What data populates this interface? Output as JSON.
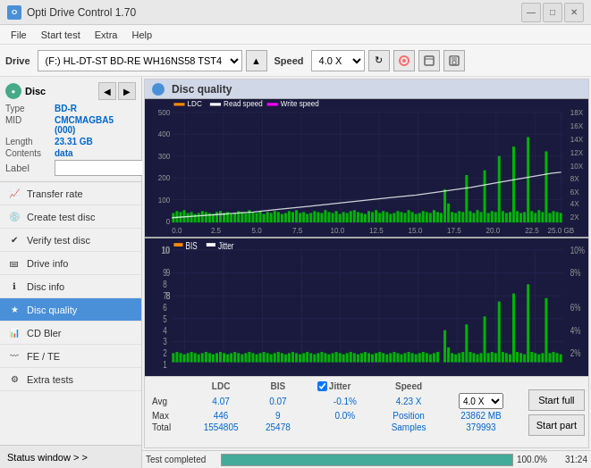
{
  "titlebar": {
    "title": "Opti Drive Control 1.70",
    "icon_text": "O",
    "min_btn": "—",
    "max_btn": "□",
    "close_btn": "✕"
  },
  "menubar": {
    "items": [
      "File",
      "Start test",
      "Extra",
      "Help"
    ]
  },
  "toolbar": {
    "drive_label": "Drive",
    "drive_value": "(F:)  HL-DT-ST BD-RE  WH16NS58 TST4",
    "speed_label": "Speed",
    "speed_value": "4.0 X"
  },
  "disc": {
    "type_label": "Type",
    "type_value": "BD-R",
    "mid_label": "MID",
    "mid_value": "CMCMAGBA5 (000)",
    "length_label": "Length",
    "length_value": "23.31 GB",
    "contents_label": "Contents",
    "contents_value": "data",
    "label_label": "Label",
    "label_value": ""
  },
  "nav": {
    "items": [
      {
        "label": "Transfer rate",
        "active": false
      },
      {
        "label": "Create test disc",
        "active": false
      },
      {
        "label": "Verify test disc",
        "active": false
      },
      {
        "label": "Drive info",
        "active": false
      },
      {
        "label": "Disc info",
        "active": false
      },
      {
        "label": "Disc quality",
        "active": true
      },
      {
        "label": "CD Bler",
        "active": false
      },
      {
        "label": "FE / TE",
        "active": false
      },
      {
        "label": "Extra tests",
        "active": false
      }
    ]
  },
  "status_window": {
    "label": "Status window > >"
  },
  "chart": {
    "title": "Disc quality",
    "legend_top": [
      {
        "label": "LDC",
        "color": "#ff8800"
      },
      {
        "label": "Read speed",
        "color": "#ffffff"
      },
      {
        "label": "Write speed",
        "color": "#ff00ff"
      }
    ],
    "legend_bottom": [
      {
        "label": "BIS",
        "color": "#ff8800"
      },
      {
        "label": "Jitter",
        "color": "#ffffff"
      }
    ],
    "top_y_labels": [
      "500",
      "400",
      "300",
      "200",
      "100",
      "0"
    ],
    "top_y_right": [
      "18X",
      "16X",
      "14X",
      "12X",
      "10X",
      "8X",
      "6X",
      "4X",
      "2X"
    ],
    "bottom_y_labels": [
      "10",
      "9",
      "8",
      "7",
      "6",
      "5",
      "4",
      "3",
      "2",
      "1"
    ],
    "bottom_y_right": [
      "10%",
      "8%",
      "6%",
      "4%",
      "2%"
    ],
    "x_labels": [
      "0.0",
      "2.5",
      "5.0",
      "7.5",
      "10.0",
      "12.5",
      "15.0",
      "17.5",
      "20.0",
      "22.5",
      "25.0 GB"
    ]
  },
  "stats": {
    "headers": [
      "",
      "LDC",
      "BIS",
      "",
      "Jitter",
      "Speed",
      ""
    ],
    "avg_label": "Avg",
    "avg_ldc": "4.07",
    "avg_bis": "0.07",
    "avg_jitter": "-0.1%",
    "max_label": "Max",
    "max_ldc": "446",
    "max_bis": "9",
    "max_jitter": "0.0%",
    "total_label": "Total",
    "total_ldc": "1554805",
    "total_bis": "25478",
    "speed_label": "Speed",
    "speed_value": "4.23 X",
    "speed_select": "4.0 X",
    "position_label": "Position",
    "position_value": "23862 MB",
    "samples_label": "Samples",
    "samples_value": "379993",
    "jitter_checked": true,
    "btn_full": "Start full",
    "btn_part": "Start part"
  },
  "progress": {
    "percent": 100,
    "percent_text": "100.0%",
    "time": "31:24"
  },
  "status_bar": {
    "text": "Test completed"
  }
}
